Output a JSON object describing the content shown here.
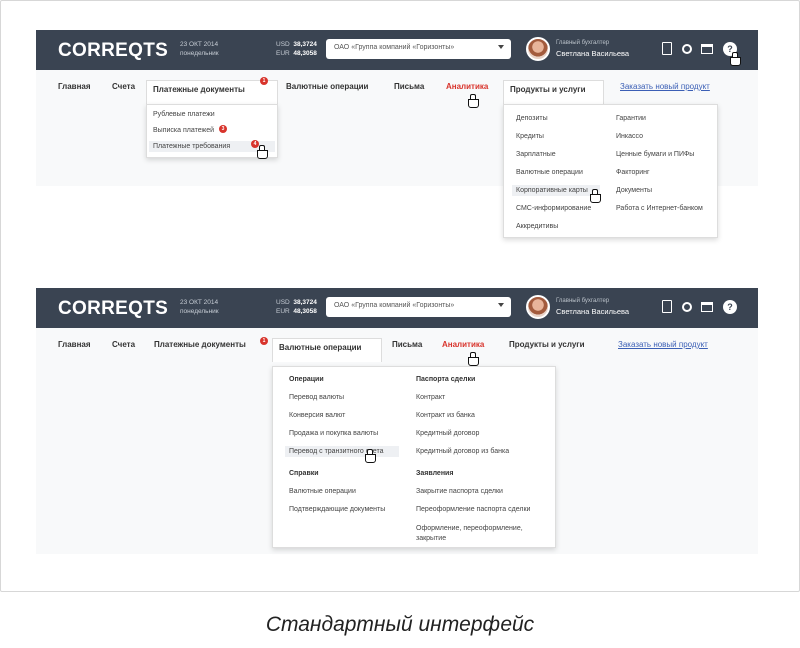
{
  "app": {
    "logo": "CORREQTS",
    "org_select": "ОАО «Группа компаний «Горизонты»",
    "user_role": "Главный бухгалтер",
    "user_name": "Светлана Васильева",
    "date_line1": "23 ОКТ 2014",
    "date_line2": "понедельник",
    "rate_usd_label": "USD",
    "rate_usd_value": "38,3724",
    "rate_eur_label": "EUR",
    "rate_eur_value": "48,3058",
    "help_glyph": "?"
  },
  "nav": {
    "home": "Главная",
    "accounts": "Счета",
    "payment_docs": "Платежные документы",
    "currency_ops": "Валютные операции",
    "letters": "Письма",
    "analytics": "Аналитика",
    "products": "Продукты и услуги",
    "link": "Заказать новый продукт",
    "badge_1": "1"
  },
  "screen1": {
    "payment_dropdown": [
      {
        "label": "Рублевые платежи",
        "badge": ""
      },
      {
        "label": "Выписка платежей",
        "badge": "3"
      },
      {
        "label": "Платежные требования",
        "badge": "4"
      }
    ],
    "products_left": [
      "Депозиты",
      "Кредиты",
      "Зарплатные",
      "Валютные операции",
      "Корпоративные карты",
      "СМС-информирование",
      "Аккредитивы"
    ],
    "products_right": [
      "Гарантии",
      "Инкассо",
      "Ценные бумаги и ПИФы",
      "Факторинг",
      "Документы",
      "Работа с Интернет-банком"
    ]
  },
  "screen2": {
    "col1_head_1": "Операции",
    "col1_items_1": [
      "Перевод валюты",
      "Конверсия валют",
      "Продажа и покупка валюты",
      "Перевод с транзитного счета"
    ],
    "col1_head_2": "Справки",
    "col1_items_2": [
      "Валютные операции",
      "Подтверждающие документы"
    ],
    "col2_head_1": "Паспорта сделки",
    "col2_items_1": [
      "Контракт",
      "Контракт из банка",
      "Кредитный договор",
      "Кредитный договор из банка"
    ],
    "col2_head_2": "Заявления",
    "col2_items_2": [
      "Закрытие паспорта сделки",
      "Переоформление паспорта сделки",
      "Оформление, переоформление, закрытие"
    ]
  },
  "caption": "Стандартный интерфейс"
}
